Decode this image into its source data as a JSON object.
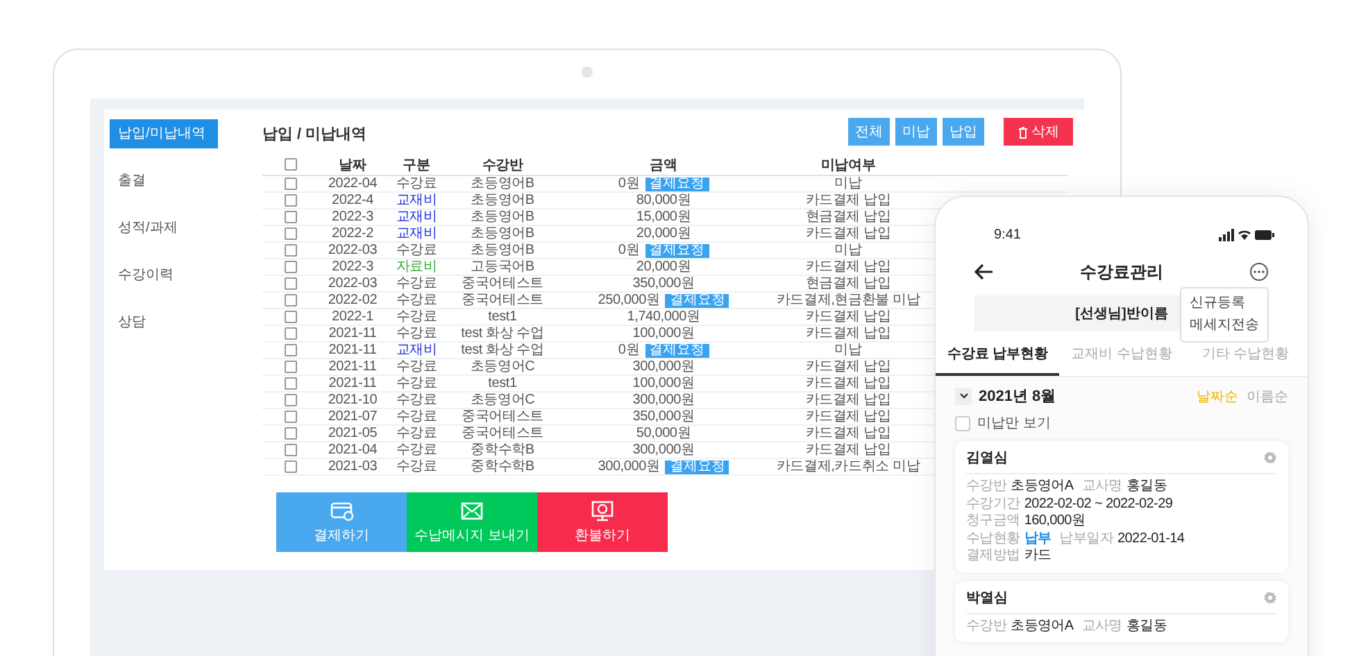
{
  "laptop": {
    "sidebar": [
      {
        "label": "납입/미납내역",
        "selected": true
      },
      {
        "label": "출결",
        "selected": false
      },
      {
        "label": "성적/과제",
        "selected": false
      },
      {
        "label": "수강이력",
        "selected": false
      },
      {
        "label": "상담",
        "selected": false
      }
    ],
    "title": "납입 / 미납내역",
    "filter_buttons": [
      {
        "label": "전체",
        "kind": "filter"
      },
      {
        "label": "미납",
        "kind": "filter"
      },
      {
        "label": "납입",
        "kind": "filter"
      },
      {
        "label": "삭제",
        "kind": "delete"
      }
    ],
    "table": {
      "header_checked": false,
      "columns": [
        "날짜",
        "구분",
        "수강반",
        "금액",
        "미납여부"
      ],
      "rows": [
        {
          "checked": false,
          "date": "2022-04",
          "category": "수강료",
          "color": "#555555",
          "class": "초등영어B",
          "amount": "0원",
          "badge": "결제요청",
          "status": "미납"
        },
        {
          "checked": false,
          "date": "2022-4",
          "category": "교재비",
          "color": "#2233dd",
          "class": "초등영어B",
          "amount": "80,000원",
          "status": "카드결제 납입"
        },
        {
          "checked": false,
          "date": "2022-3",
          "category": "교재비",
          "color": "#2233dd",
          "class": "초등영어B",
          "amount": "15,000원",
          "status": "현금결제 납입"
        },
        {
          "checked": false,
          "date": "2022-2",
          "category": "교재비",
          "color": "#2233dd",
          "class": "초등영어B",
          "amount": "20,000원",
          "status": "카드결제 납입"
        },
        {
          "checked": false,
          "date": "2022-03",
          "category": "수강료",
          "color": "#555555",
          "class": "초등영어B",
          "amount": "0원",
          "badge": "결제요청",
          "status": "미납"
        },
        {
          "checked": false,
          "date": "2022-3",
          "category": "자료비",
          "color": "#33aa33",
          "class": "고등국어B",
          "amount": "20,000원",
          "status": "카드결제 납입"
        },
        {
          "checked": false,
          "date": "2022-03",
          "category": "수강료",
          "color": "#555555",
          "class": "중국어테스트",
          "amount": "350,000원",
          "status": "현금결제 납입"
        },
        {
          "checked": false,
          "date": "2022-02",
          "category": "수강료",
          "color": "#555555",
          "class": "중국어테스트",
          "amount": "250,000원",
          "badge": "결제요청",
          "status": "카드결제,현금환불 미납"
        },
        {
          "checked": false,
          "date": "2022-1",
          "category": "수강료",
          "color": "#555555",
          "class": "test1",
          "amount": "1,740,000원",
          "status": "카드결제 납입"
        },
        {
          "checked": false,
          "date": "2021-11",
          "category": "수강료",
          "color": "#555555",
          "class": "test 화상 수업",
          "amount": "100,000원",
          "status": "카드결제 납입"
        },
        {
          "checked": false,
          "date": "2021-11",
          "category": "교재비",
          "color": "#2233dd",
          "class": "test 화상 수업",
          "amount": "0원",
          "badge": "결제요청",
          "status": "미납"
        },
        {
          "checked": false,
          "date": "2021-11",
          "category": "수강료",
          "color": "#555555",
          "class": "초등영어C",
          "amount": "300,000원",
          "status": "카드결제 납입"
        },
        {
          "checked": false,
          "date": "2021-11",
          "category": "수강료",
          "color": "#555555",
          "class": "test1",
          "amount": "100,000원",
          "status": "카드결제 납입"
        },
        {
          "checked": false,
          "date": "2021-10",
          "category": "수강료",
          "color": "#555555",
          "class": "초등영어C",
          "amount": "300,000원",
          "status": "카드결제 납입"
        },
        {
          "checked": false,
          "date": "2021-07",
          "category": "수강료",
          "color": "#555555",
          "class": "중국어테스트",
          "amount": "350,000원",
          "status": "카드결제 납입"
        },
        {
          "checked": false,
          "date": "2021-05",
          "category": "수강료",
          "color": "#555555",
          "class": "중국어테스트",
          "amount": "50,000원",
          "status": "카드결제 납입"
        },
        {
          "checked": false,
          "date": "2021-04",
          "category": "수강료",
          "color": "#555555",
          "class": "중학수학B",
          "amount": "300,000원",
          "status": "카드결제 납입"
        },
        {
          "checked": false,
          "date": "2021-03",
          "category": "수강료",
          "color": "#555555",
          "class": "중학수학B",
          "amount": "300,000원",
          "badge": "결제요청",
          "status": "카드결제,카드취소 미납"
        }
      ]
    },
    "action_buttons": [
      {
        "label": "결제하기",
        "kind": "pay"
      },
      {
        "label": "수납메시지 보내기",
        "kind": "message"
      },
      {
        "label": "환불하기",
        "kind": "refund"
      }
    ]
  },
  "phone": {
    "time": "9:41",
    "title": "수강료관리",
    "menu": [
      "신규등록",
      "메세지전송"
    ],
    "class_name": "[선생님]반이름",
    "tabs": [
      {
        "label": "수강료 납부현황",
        "selected": true
      },
      {
        "label": "교재비 수납현황",
        "selected": false
      },
      {
        "label": "기타 수납현황",
        "selected": false
      }
    ],
    "month": "2021년 8월",
    "sort": [
      {
        "label": "날짜순",
        "selected": true
      },
      {
        "label": "이름순",
        "selected": false
      }
    ],
    "unpaid_only": {
      "label": "미납만 보기",
      "checked": false
    },
    "cards": [
      {
        "name": "김열심",
        "lines": [
          [
            {
              "label": "수강반",
              "value": "초등영어A",
              "kind": "plain"
            },
            {
              "label": "교사명",
              "value": "홍길동",
              "kind": "plain"
            }
          ],
          [
            {
              "label": "수강기간",
              "value": "2022-02-02 ~ 2022-02-29",
              "kind": "plain"
            },
            {
              "label": "청구금액",
              "value": "160,000원",
              "kind": "plain"
            }
          ],
          [
            {
              "label": "수납현황",
              "value": "납부",
              "kind": "status"
            },
            {
              "label": "납부일자",
              "value": "2022-01-14",
              "kind": "plain"
            },
            {
              "label": "결제방법",
              "value": "카드",
              "kind": "plain"
            }
          ]
        ]
      },
      {
        "name": "박열심",
        "lines": [
          [
            {
              "label": "수강반",
              "value": "초등영어A",
              "kind": "plain"
            },
            {
              "label": "교사명",
              "value": "홍길동",
              "kind": "plain"
            }
          ]
        ]
      }
    ]
  }
}
